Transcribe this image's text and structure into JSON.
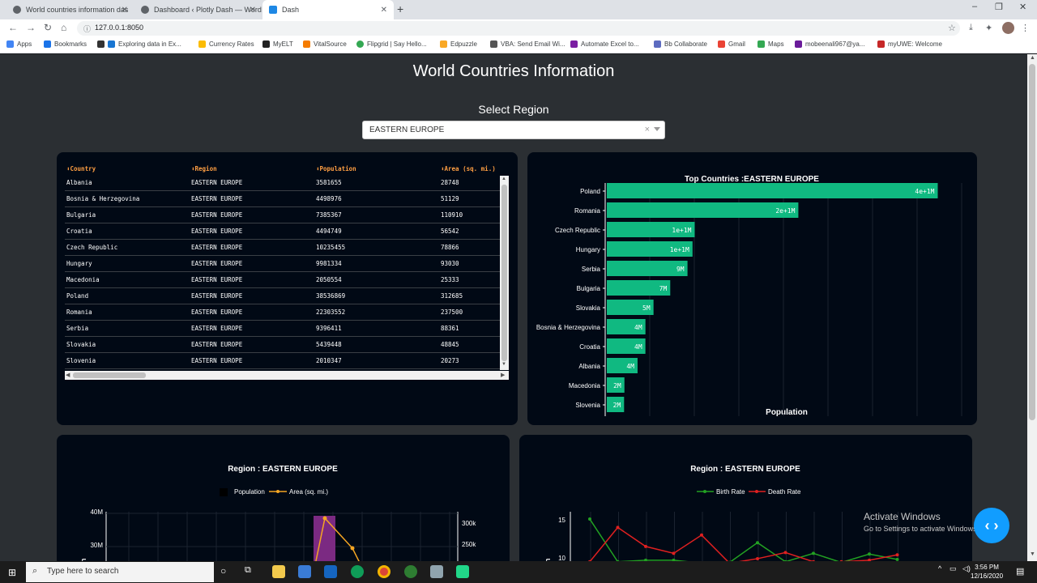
{
  "browser": {
    "tabs": [
      {
        "title": "World countries information das",
        "active": false
      },
      {
        "title": "Dashboard ‹ Plotly Dash — Word",
        "active": false
      },
      {
        "title": "Dash",
        "active": true
      }
    ],
    "url": "127.0.0.1:8050",
    "bookmarks": [
      "Apps",
      "Bookmarks",
      "Exploring data in Ex...",
      "Currency Rates",
      "MyELT",
      "VitalSource",
      "Flipgrid | Say Hello...",
      "Edpuzzle",
      "VBA: Send Email Wi...",
      "Automate Excel to...",
      "Bb Collaborate",
      "Gmail",
      "Maps",
      "mobeenali967@ya...",
      "myUWE: Welcome"
    ]
  },
  "page": {
    "title": "World Countries Information",
    "select_label": "Select Region",
    "selected_region": "EASTERN EUROPE"
  },
  "table": {
    "headers": [
      "⬍Country",
      "⬍Region",
      "⬍Population",
      "⬍Area (sq. mi.)"
    ],
    "rows": [
      [
        "Albania",
        "EASTERN EUROPE",
        "3581655",
        "28748"
      ],
      [
        "Bosnia & Herzegovina",
        "EASTERN EUROPE",
        "4498976",
        "51129"
      ],
      [
        "Bulgaria",
        "EASTERN EUROPE",
        "7385367",
        "110910"
      ],
      [
        "Croatia",
        "EASTERN EUROPE",
        "4494749",
        "56542"
      ],
      [
        "Czech Republic",
        "EASTERN EUROPE",
        "10235455",
        "78866"
      ],
      [
        "Hungary",
        "EASTERN EUROPE",
        "9981334",
        "93030"
      ],
      [
        "Macedonia",
        "EASTERN EUROPE",
        "2050554",
        "25333"
      ],
      [
        "Poland",
        "EASTERN EUROPE",
        "38536869",
        "312685"
      ],
      [
        "Romania",
        "EASTERN EUROPE",
        "22303552",
        "237500"
      ],
      [
        "Serbia",
        "EASTERN EUROPE",
        "9396411",
        "88361"
      ],
      [
        "Slovakia",
        "EASTERN EUROPE",
        "5439448",
        "48845"
      ],
      [
        "Slovenia",
        "EASTERN EUROPE",
        "2010347",
        "20273"
      ]
    ]
  },
  "chart_data": [
    {
      "type": "bar",
      "orientation": "horizontal",
      "title": "Top Countries :EASTERN EUROPE",
      "xlabel": "Population",
      "categories": [
        "Poland",
        "Romania",
        "Czech Republic",
        "Hungary",
        "Serbia",
        "Bulgaria",
        "Slovakia",
        "Bosnia & Herzegovina",
        "Croatia",
        "Albania",
        "Macedonia",
        "Slovenia"
      ],
      "values": [
        38536869,
        22303552,
        10235455,
        9981334,
        9396411,
        7385367,
        5439448,
        4498976,
        4494749,
        3581655,
        2050554,
        2010347
      ],
      "labels": [
        "4e+1M",
        "2e+1M",
        "1e+1M",
        "1e+1M",
        "9M",
        "7M",
        "5M",
        "4M",
        "4M",
        "4M",
        "2M",
        "2M"
      ],
      "color": "#10b981"
    },
    {
      "type": "bar",
      "title": "Region : EASTERN EUROPE",
      "legend": [
        "Population",
        "Area (sq. mi.)"
      ],
      "y_ticks": [
        "40M",
        "30M"
      ],
      "y2_ticks": [
        "300k",
        "250k"
      ],
      "ylabel_partial": "n",
      "highlight_color": "#7b2a82",
      "line_color": "#f5a623"
    },
    {
      "type": "line",
      "title": "Region : EASTERN EUROPE",
      "legend": [
        "Birth Rate",
        "Death Rate"
      ],
      "y_ticks": [
        "15",
        "10"
      ],
      "ylabel_partial": "n",
      "series_colors": [
        "#22a022",
        "#e02020"
      ],
      "birth_rate": [
        15.1,
        9.5,
        9.7,
        9.7,
        9.3,
        9.4,
        12.0,
        9.5,
        10.6,
        9.4,
        10.5,
        9.8
      ],
      "death_rate": [
        9.5,
        14.0,
        11.5,
        10.6,
        13.0,
        9.3,
        9.9,
        10.7,
        9.5,
        9.5,
        9.7,
        10.4
      ]
    }
  ],
  "overlay": {
    "activate_title": "Activate Windows",
    "activate_sub": "Go to Settings to activate Windows."
  },
  "taskbar": {
    "search_placeholder": "Type here to search",
    "time": "3:56 PM",
    "date": "12/16/2020"
  }
}
